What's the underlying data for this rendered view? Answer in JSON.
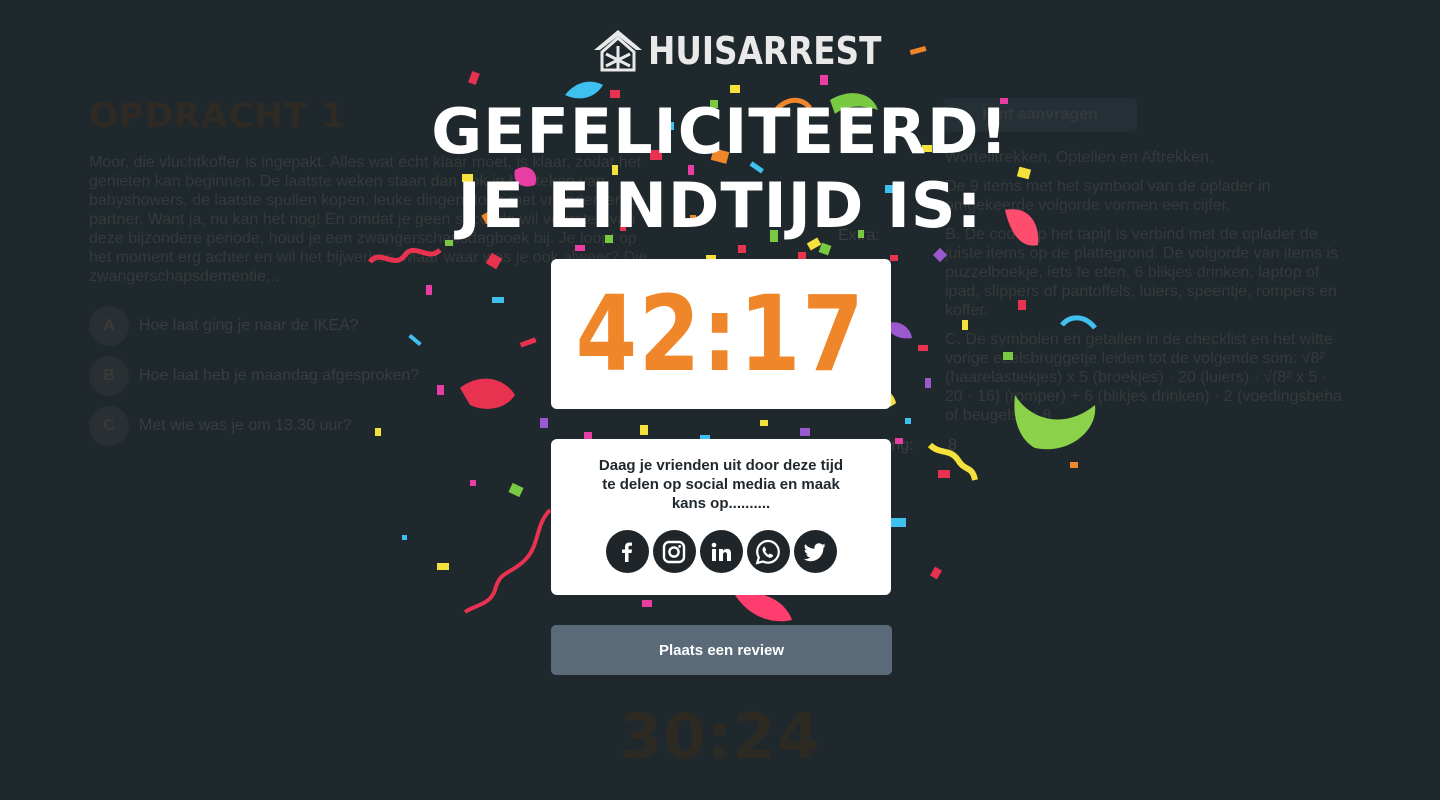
{
  "brand": {
    "name": "HUISARREST"
  },
  "background": {
    "title": "OPDRACHT 1",
    "intro": "Moor, die vluchtkoffer is ingepakt. Alles wat écht klaar moet, is klaar, zodat het genieten kan beginnen. De laatste weken staan dan ook in het teken van babyshowers, de laatste spullen kopen, leuke dingen doen met vrienden en de partner. Want ja, nu kan het nog! En omdat je geen seconde wil vergeten van deze bijzondere periode, houd je een zwangerschapsdagboek bij. Je loopt op het moment erg achter en wil het bijwerken. Maar waar was je ook alweer? Die zwangerschapsdementie...",
    "questions": [
      {
        "letter": "A",
        "text": "Hoe laat ging je naar de IKEA?"
      },
      {
        "letter": "B",
        "text": "Hoe laat heb je maandag afgesproken?"
      },
      {
        "letter": "C",
        "text": "Met wie was je om 13.30 uur?"
      }
    ],
    "hint_button": "Hint aanvragen",
    "hint_lines": [
      "Wortelltrekken, Optellen en Aftrekken.",
      "De 9 items met het symbool van de oplader in omgekeerde volgorde vormen een cijfer.",
      "B. De code op het tapijt is verbind met de oplader de juiste items op de plattegrond. De volgorde van items is puzzelboekje, iets te eten, 6 blikjes drinken, laptop of ipad, slippers of pantoffels, luiers, speentje, rompers en koffer.",
      "C. De symbolen en getallen in de checklist en het witte vorige ezelsbruggetje leiden tot de volgende som: √8² (haarelastiekjes) x 5 (broekjes) · 20 (luiers) · √(8² x 5 · 20 · 16) (romper) + 6 (blikjes drinken) · 2 (voedingsbeha of beugels) = 8"
    ],
    "extra_label": "Extra:",
    "oplossing_label": "Oplossing:",
    "oplossing_value": "8",
    "timer": "30:24"
  },
  "modal": {
    "headline_1": "Gefeliciteerd!",
    "headline_2": "Je eindtijd is:",
    "final_time": "42:17",
    "share_text": "Daag je vrienden uit door deze tijd te delen op social media en maak kans op..........",
    "socials": [
      "facebook-icon",
      "instagram-icon",
      "linkedin-icon",
      "whatsapp-icon",
      "twitter-icon"
    ],
    "review_button": "Plaats een review"
  },
  "colors": {
    "background": "#1f282d",
    "accent_orange": "#f0862a",
    "review_button": "#5a6a79"
  }
}
